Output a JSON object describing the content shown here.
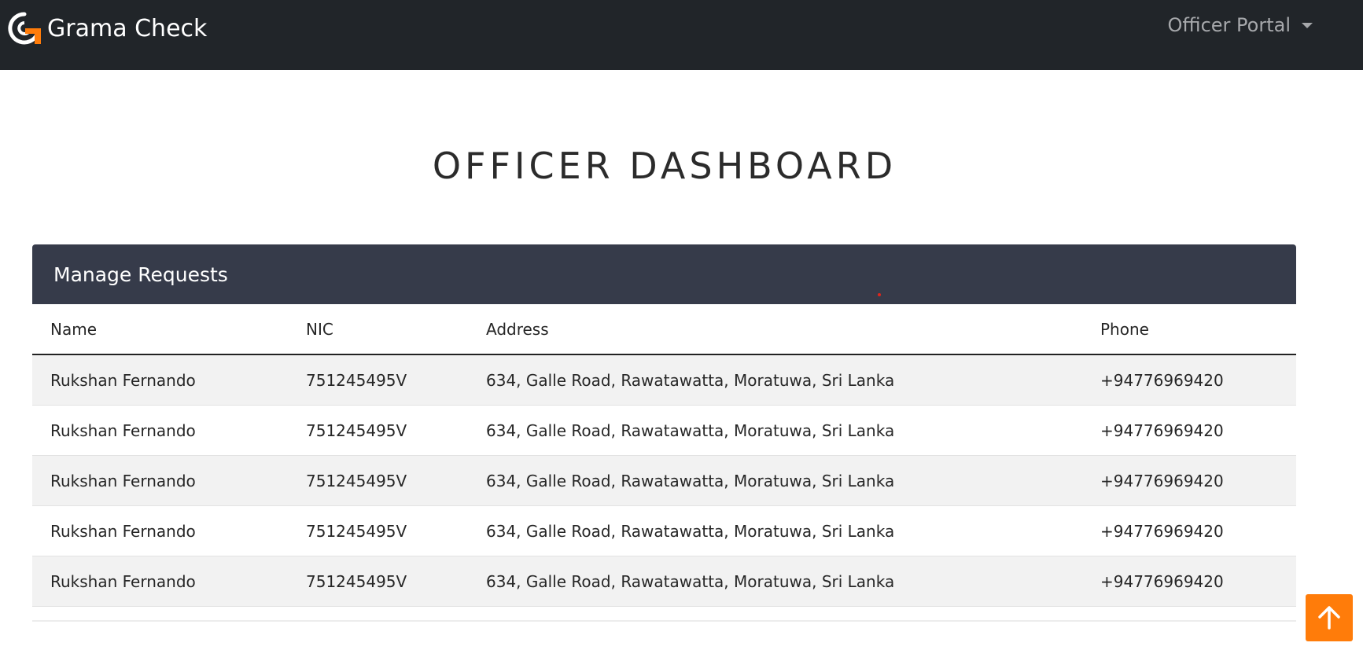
{
  "navbar": {
    "brand_name": "Grama Check",
    "portal_label": "Officer Portal"
  },
  "page": {
    "title": "OFFICER DASHBOARD"
  },
  "requests_card": {
    "title": "Manage Requests",
    "columns": [
      "Name",
      "NIC",
      "Address",
      "Phone"
    ],
    "rows": [
      {
        "name": "Rukshan Fernando",
        "nic": "751245495V",
        "address": "634, Galle Road, Rawatawatta, Moratuwa, Sri Lanka",
        "phone": "+94776969420"
      },
      {
        "name": "Rukshan Fernando",
        "nic": "751245495V",
        "address": "634, Galle Road, Rawatawatta, Moratuwa, Sri Lanka",
        "phone": "+94776969420"
      },
      {
        "name": "Rukshan Fernando",
        "nic": "751245495V",
        "address": "634, Galle Road, Rawatawatta, Moratuwa, Sri Lanka",
        "phone": "+94776969420"
      },
      {
        "name": "Rukshan Fernando",
        "nic": "751245495V",
        "address": "634, Galle Road, Rawatawatta, Moratuwa, Sri Lanka",
        "phone": "+94776969420"
      },
      {
        "name": "Rukshan Fernando",
        "nic": "751245495V",
        "address": "634, Galle Road, Rawatawatta, Moratuwa, Sri Lanka",
        "phone": "+94776969420"
      }
    ]
  },
  "icons": {
    "brand_logo": "grama-check-logo",
    "portal_dropdown": "caret-down-icon",
    "back_to_top": "arrow-up-icon"
  },
  "colors": {
    "navbar_bg": "#212529",
    "card_header_bg": "#363b4a",
    "accent_orange": "#ff7c0a",
    "striped_row_bg": "#f2f2f2"
  }
}
